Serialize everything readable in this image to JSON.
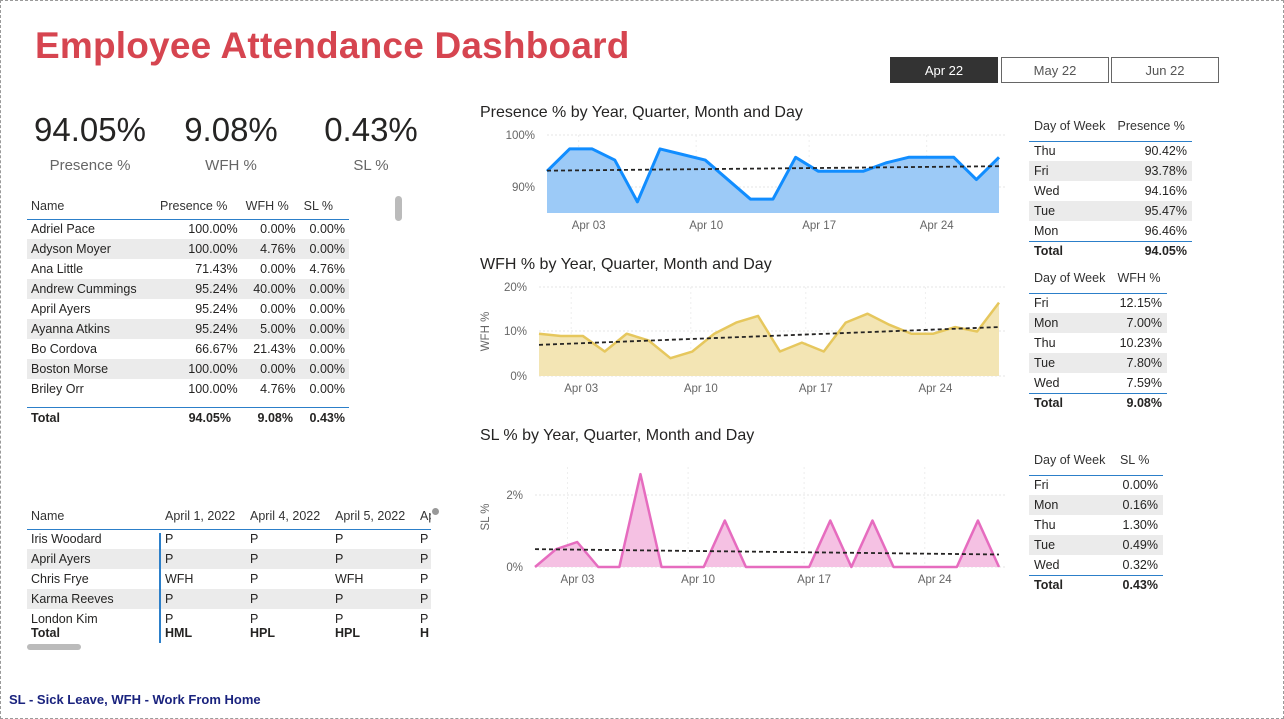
{
  "title": "Employee Attendance Dashboard",
  "tabs": [
    {
      "label": "Apr 22",
      "active": true
    },
    {
      "label": "May 22",
      "active": false
    },
    {
      "label": "Jun 22",
      "active": false
    }
  ],
  "kpis": [
    {
      "value": "94.05%",
      "label": "Presence %"
    },
    {
      "value": "9.08%",
      "label": "WFH %"
    },
    {
      "value": "0.43%",
      "label": "SL %"
    }
  ],
  "emp_table": {
    "headers": [
      "Name",
      "Presence %",
      "WFH %",
      "SL %"
    ],
    "rows": [
      [
        "Adriel Pace",
        "100.00%",
        "0.00%",
        "0.00%"
      ],
      [
        "Adyson Moyer",
        "100.00%",
        "4.76%",
        "0.00%"
      ],
      [
        "Ana Little",
        "71.43%",
        "0.00%",
        "4.76%"
      ],
      [
        "Andrew Cummings",
        "95.24%",
        "40.00%",
        "0.00%"
      ],
      [
        "April Ayers",
        "95.24%",
        "0.00%",
        "0.00%"
      ],
      [
        "Ayanna Atkins",
        "95.24%",
        "5.00%",
        "0.00%"
      ],
      [
        "Bo Cordova",
        "66.67%",
        "21.43%",
        "0.00%"
      ],
      [
        "Boston Morse",
        "100.00%",
        "0.00%",
        "0.00%"
      ],
      [
        "Briley Orr",
        "100.00%",
        "4.76%",
        "0.00%"
      ]
    ],
    "total": [
      "Total",
      "94.05%",
      "9.08%",
      "0.43%"
    ]
  },
  "daily_table": {
    "headers": [
      "Name",
      "April 1, 2022",
      "April 4, 2022",
      "April 5, 2022",
      "Ap"
    ],
    "rows": [
      [
        "Iris Woodard",
        "P",
        "P",
        "P",
        "P"
      ],
      [
        "April Ayers",
        "P",
        "P",
        "P",
        "P"
      ],
      [
        "Chris Frye",
        "WFH",
        "P",
        "WFH",
        "P"
      ],
      [
        "Karma Reeves",
        "P",
        "P",
        "P",
        "P"
      ],
      [
        "London Kim",
        "P",
        "P",
        "P",
        "P"
      ]
    ],
    "total": [
      "Total",
      "HML",
      "HPL",
      "HPL",
      "H"
    ]
  },
  "presence_dow": {
    "headers": [
      "Day of Week",
      "Presence %"
    ],
    "rows": [
      [
        "Thu",
        "90.42%"
      ],
      [
        "Fri",
        "93.78%"
      ],
      [
        "Wed",
        "94.16%"
      ],
      [
        "Tue",
        "95.47%"
      ],
      [
        "Mon",
        "96.46%"
      ]
    ],
    "total": [
      "Total",
      "94.05%"
    ]
  },
  "wfh_dow": {
    "headers": [
      "Day of Week",
      "WFH %"
    ],
    "rows": [
      [
        "Fri",
        "12.15%"
      ],
      [
        "Mon",
        "7.00%"
      ],
      [
        "Thu",
        "10.23%"
      ],
      [
        "Tue",
        "7.80%"
      ],
      [
        "Wed",
        "7.59%"
      ]
    ],
    "total": [
      "Total",
      "9.08%"
    ]
  },
  "sl_dow": {
    "headers": [
      "Day of Week",
      "SL %"
    ],
    "rows": [
      [
        "Fri",
        "0.00%"
      ],
      [
        "Mon",
        "0.16%"
      ],
      [
        "Thu",
        "1.30%"
      ],
      [
        "Tue",
        "0.49%"
      ],
      [
        "Wed",
        "0.32%"
      ]
    ],
    "total": [
      "Total",
      "0.43%"
    ]
  },
  "footer": "SL - Sick Leave, WFH - Work From Home",
  "chart_data": [
    {
      "type": "area",
      "title": "Presence % by Year, Quarter, Month and Day",
      "xlabel": "",
      "ylabel": "",
      "color": "#118dff",
      "fill": "#9ccaf7",
      "x": [
        "Apr 01",
        "Apr 04",
        "Apr 05",
        "Apr 06",
        "Apr 07",
        "Apr 08",
        "Apr 11",
        "Apr 12",
        "Apr 13",
        "Apr 14",
        "Apr 15",
        "Apr 18",
        "Apr 19",
        "Apr 20",
        "Apr 21",
        "Apr 22",
        "Apr 25",
        "Apr 26",
        "Apr 27",
        "Apr 28",
        "Apr 29"
      ],
      "values": [
        93.5,
        97.5,
        97.5,
        95.5,
        88,
        97.5,
        96.5,
        95.5,
        92,
        88.5,
        88.5,
        96,
        93.5,
        93.5,
        93.5,
        95,
        96,
        96,
        96,
        92,
        96
      ],
      "ylim": [
        86,
        100
      ],
      "yticks": [
        "100%",
        "90%"
      ],
      "xticks": [
        "Apr 03",
        "Apr 10",
        "Apr 17",
        "Apr 24"
      ],
      "trend": [
        93.6,
        94.4
      ]
    },
    {
      "type": "area",
      "title": "WFH % by Year, Quarter, Month and Day",
      "xlabel": "",
      "ylabel": "WFH %",
      "color": "#e6c75d",
      "fill": "#f3e5b4",
      "values": [
        9.5,
        9,
        9,
        5.5,
        9.5,
        8,
        4,
        5.5,
        9.5,
        12,
        13.5,
        5.5,
        7.5,
        5.5,
        12,
        14,
        11.5,
        9.5,
        9.5,
        11,
        10,
        16.5
      ],
      "ylim": [
        0,
        20
      ],
      "yticks": [
        "20%",
        "10%",
        "0%"
      ],
      "xticks": [
        "Apr 03",
        "Apr 10",
        "Apr 17",
        "Apr 24"
      ],
      "trend": [
        7,
        11
      ]
    },
    {
      "type": "area",
      "title": "SL % by Year, Quarter, Month and Day",
      "xlabel": "",
      "ylabel": "SL %",
      "color": "#e66cbf",
      "fill": "#f5c1e3",
      "values": [
        0,
        0.5,
        0.7,
        0,
        0,
        2.6,
        0,
        0,
        0,
        1.3,
        0,
        0,
        0,
        0,
        1.3,
        0,
        1.3,
        0,
        0,
        0,
        0,
        1.3,
        0
      ],
      "ylim": [
        0,
        2.8
      ],
      "yticks": [
        "2%",
        "0%"
      ],
      "xticks": [
        "Apr 03",
        "Apr 10",
        "Apr 17",
        "Apr 24"
      ],
      "trend": [
        0.5,
        0.35
      ]
    }
  ]
}
